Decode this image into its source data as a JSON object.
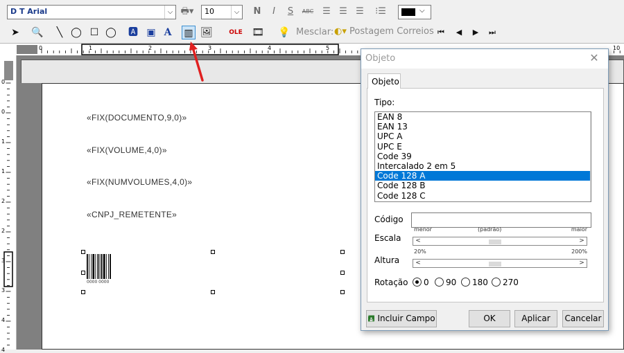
{
  "toolbar": {
    "font_name": "D T Arial",
    "font_size": "10",
    "bold_label": "N",
    "italic_label": "I",
    "underline_label": "S",
    "strike_label": "ABC",
    "mesclar_label": "Mesclar:",
    "postagem_label": "Postagem Correios"
  },
  "ruler": {
    "h_numbers": [
      "0",
      "1",
      "2",
      "3",
      "4",
      "5",
      "10"
    ],
    "v_numbers": [
      "0",
      "0",
      "1",
      "1",
      "2",
      "2",
      "3",
      "3",
      "4",
      "4"
    ]
  },
  "page": {
    "fields": [
      "«FIX(DOCUMENTO,9,0)»",
      "«FIX(VOLUME,4,0)»",
      "«FIX(NUMVOLUMES,4,0)»",
      "«CNPJ_REMETENTE»"
    ],
    "barcode_text": "0000 0000"
  },
  "dialog": {
    "title": "Objeto",
    "close_glyph": "✕",
    "tab_label": "Objeto",
    "tipo_label": "Tipo:",
    "tipo_options": [
      "EAN 8",
      "EAN 13",
      "UPC A",
      "UPC E",
      "Code 39",
      "Intercalado 2 em 5",
      "Code 128 A",
      "Code 128 B",
      "Code 128 C"
    ],
    "tipo_selected": "Code 128 A",
    "codigo_label": "Código",
    "codigo_value": "",
    "escala_label": "Escala",
    "escala_min": "menor",
    "escala_mid": "(padrão)",
    "escala_max": "maior",
    "escala_level": 0.45,
    "altura_label": "Altura",
    "altura_min": "20%",
    "altura_max": "200%",
    "altura_level": 0.45,
    "rotacao_label": "Rotação",
    "rotacao_options": [
      "0",
      "90",
      "180",
      "270"
    ],
    "rotacao_selected": "0",
    "btn_incluir": "Incluir Campo",
    "btn_ok": "OK",
    "btn_aplicar": "Aplicar",
    "btn_cancelar": "Cancelar"
  },
  "colors": {
    "selection": "#0078d7",
    "arrow": "#e02020",
    "workspace": "#808080"
  }
}
